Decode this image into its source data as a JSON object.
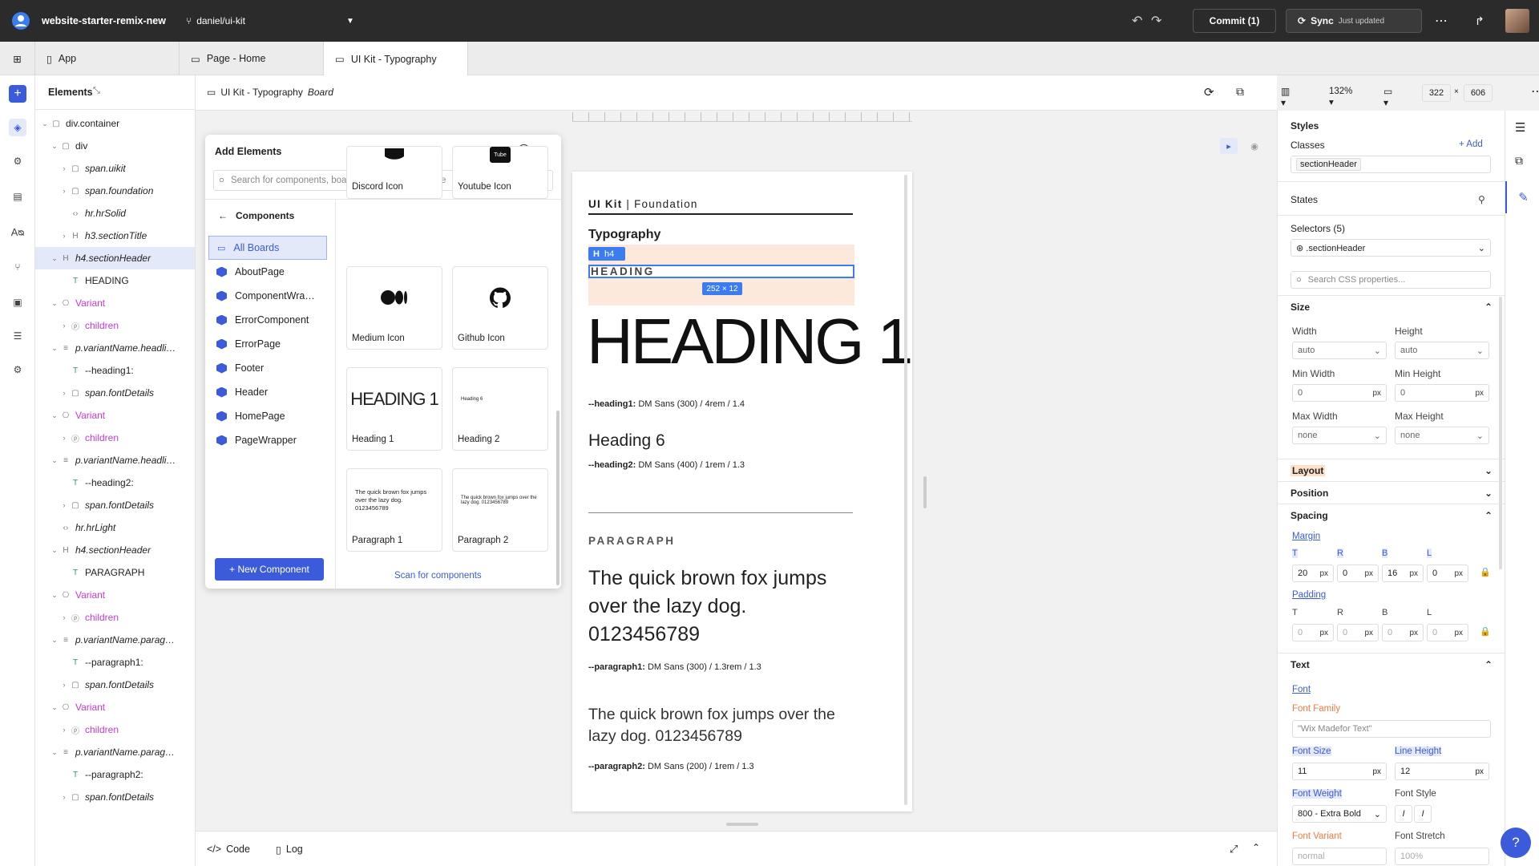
{
  "topbar": {
    "project": "website-starter-remix-new",
    "branch": "daniel/ui-kit",
    "commit": "Commit (1)",
    "sync": "Sync",
    "sync_status": "Just updated"
  },
  "tabs": [
    {
      "label": "App"
    },
    {
      "label": "Page - Home"
    },
    {
      "label": "UI Kit - Typography"
    }
  ],
  "elements_panel": {
    "title": "Elements",
    "tree": [
      {
        "label": "div.container",
        "italic": false,
        "kind": "div"
      },
      {
        "label": "div",
        "italic": false,
        "kind": "div"
      },
      {
        "label": "span.uikit",
        "italic": true,
        "kind": "span"
      },
      {
        "label": "span.foundation",
        "italic": true,
        "kind": "span"
      },
      {
        "label": "hr.hrSolid",
        "italic": true,
        "kind": "code"
      },
      {
        "label": "h3.sectionTitle",
        "italic": true,
        "kind": "h"
      },
      {
        "label": "h4.sectionHeader",
        "italic": true,
        "kind": "h"
      },
      {
        "label": "HEADING",
        "italic": false,
        "kind": "t"
      },
      {
        "label": "Variant",
        "italic": false,
        "kind": "variant"
      },
      {
        "label": "children",
        "italic": false,
        "kind": "children"
      },
      {
        "label": "p.variantName.headli…",
        "italic": true,
        "kind": "p"
      },
      {
        "label": "--heading1:",
        "italic": false,
        "kind": "t"
      },
      {
        "label": "span.fontDetails",
        "italic": true,
        "kind": "span"
      },
      {
        "label": "Variant",
        "italic": false,
        "kind": "variant"
      },
      {
        "label": "children",
        "italic": false,
        "kind": "children"
      },
      {
        "label": "p.variantName.headli…",
        "italic": true,
        "kind": "p"
      },
      {
        "label": "--heading2:",
        "italic": false,
        "kind": "t"
      },
      {
        "label": "span.fontDetails",
        "italic": true,
        "kind": "span"
      },
      {
        "label": "hr.hrLight",
        "italic": true,
        "kind": "code"
      },
      {
        "label": "h4.sectionHeader",
        "italic": true,
        "kind": "h"
      },
      {
        "label": "PARAGRAPH",
        "italic": false,
        "kind": "t"
      },
      {
        "label": "Variant",
        "italic": false,
        "kind": "variant"
      },
      {
        "label": "children",
        "italic": false,
        "kind": "children"
      },
      {
        "label": "p.variantName.parag…",
        "italic": true,
        "kind": "p"
      },
      {
        "label": "--paragraph1:",
        "italic": false,
        "kind": "t"
      },
      {
        "label": "span.fontDetails",
        "italic": true,
        "kind": "span"
      },
      {
        "label": "Variant",
        "italic": false,
        "kind": "variant"
      },
      {
        "label": "children",
        "italic": false,
        "kind": "children"
      },
      {
        "label": "p.variantName.parag…",
        "italic": true,
        "kind": "p"
      },
      {
        "label": "--paragraph2:",
        "italic": false,
        "kind": "t"
      },
      {
        "label": "span.fontDetails",
        "italic": true,
        "kind": "span"
      }
    ]
  },
  "canvas_bar": {
    "title": "UI Kit - Typography",
    "title_suffix": "Board",
    "zoom": "132%",
    "width": "322",
    "times": "×",
    "height": "606"
  },
  "add_elements": {
    "title": "Add Elements",
    "search_placeholder": "Search for components, boards, elements, and more",
    "back_label": "Components",
    "components": [
      "All Boards",
      "AboutPage",
      "ComponentWra…",
      "ErrorComponent",
      "ErrorPage",
      "Footer",
      "Header",
      "HomePage",
      "PageWrapper"
    ],
    "cards": [
      {
        "label": "Discord Icon"
      },
      {
        "label": "Youtube Icon"
      },
      {
        "label": "Medium Icon"
      },
      {
        "label": "Github Icon"
      },
      {
        "label": "Heading 1",
        "preview": "HEADING 1"
      },
      {
        "label": "Heading 2",
        "preview": "Heading 6"
      },
      {
        "label": "Paragraph 1",
        "preview": "The quick brown fox jumps over the lazy dog. 0123456789"
      },
      {
        "label": "Paragraph 2",
        "preview": "The quick brown fox jumps over the lazy dog. 0123456789"
      }
    ],
    "new_component": "+ New Component",
    "scan": "Scan for components"
  },
  "board": {
    "kit": "UI Kit",
    "sep": "|",
    "foundation": "Foundation",
    "typography": "Typography",
    "badge": "h4",
    "heading_label": "HEADING",
    "size_badge": "252 × 12",
    "heading1": "HEADING 1",
    "h1_var": "--heading1:",
    "h1_details": "DM Sans (300) / 4rem / 1.4",
    "heading6": "Heading 6",
    "h2_var": "--heading2:",
    "h2_details": "DM Sans (400) / 1rem / 1.3",
    "paragraph_label": "PARAGRAPH",
    "para1": "The quick brown fox jumps over the lazy dog. 0123456789",
    "p1_var": "--paragraph1:",
    "p1_details": "DM Sans (300) / 1.3rem / 1.3",
    "para2": "The quick brown fox jumps over the lazy dog. 0123456789",
    "p2_var": "--paragraph2:",
    "p2_details": "DM Sans (200) / 1rem / 1.3"
  },
  "styles": {
    "title": "Styles",
    "classes": "Classes",
    "add": "+ Add",
    "class_value": "sectionHeader",
    "states": "States",
    "selectors": "Selectors (5)",
    "selector_value": ".sectionHeader",
    "css_search": "Search CSS properties...",
    "size": {
      "title": "Size",
      "width": "Width",
      "width_val": "auto",
      "height": "Height",
      "height_val": "auto",
      "min_width": "Min Width",
      "min_width_val": "0",
      "min_height": "Min Height",
      "min_height_val": "0",
      "max_width": "Max Width",
      "max_width_val": "none",
      "max_height": "Max Height",
      "max_height_val": "none",
      "unit": "px"
    },
    "layout": "Layout",
    "position": "Position",
    "spacing": {
      "title": "Spacing",
      "margin": "Margin",
      "padding": "Padding",
      "sides": [
        "T",
        "R",
        "B",
        "L"
      ],
      "margin_vals": [
        "20",
        "0",
        "16",
        "0"
      ],
      "padding_vals": [
        "0",
        "0",
        "0",
        "0"
      ],
      "unit": "px"
    },
    "text": {
      "title": "Text",
      "font": "Font",
      "font_family": "Font Family",
      "font_family_val": "\"Wix Madefor Text\"",
      "font_size": "Font Size",
      "font_size_val": "11",
      "line_height": "Line Height",
      "line_height_val": "12",
      "font_weight": "Font Weight",
      "font_weight_val": "800 - Extra Bold",
      "font_style": "Font Style",
      "font_variant": "Font Variant",
      "font_variant_val": "normal",
      "font_stretch": "Font Stretch",
      "font_stretch_val": "100%",
      "unit": "px"
    }
  },
  "bottom": {
    "code": "Code",
    "log": "Log"
  },
  "help": "?",
  "colors": {
    "accent": "#3b5bdb",
    "pink": "#c43bd4",
    "orange": "#f07b3f",
    "topbar": "#2b2b2b",
    "highlight": "#fde9dc"
  }
}
